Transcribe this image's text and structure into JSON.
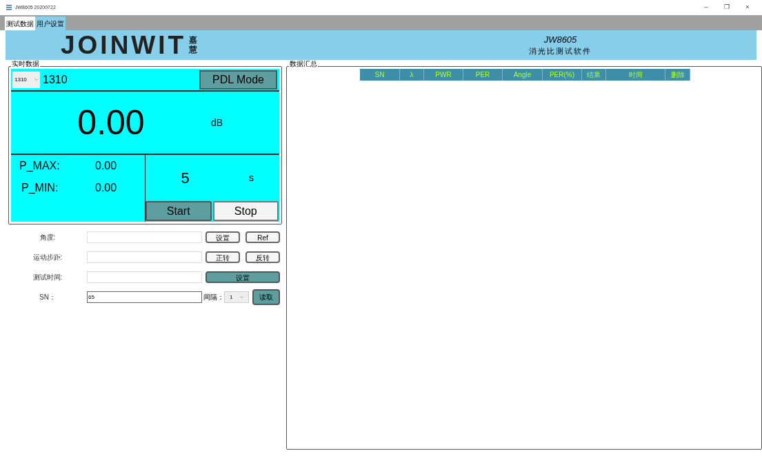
{
  "window": {
    "title": "JW8605 20200722",
    "controls": [
      "–",
      "❐",
      "×"
    ]
  },
  "tabs": [
    {
      "label": "测试数据",
      "selected": true
    },
    {
      "label": "用户设置",
      "selected": false
    }
  ],
  "header": {
    "logo": "JOINWIT",
    "logo_cn": "嘉慧",
    "model": "JW8605",
    "subtitle": "消光比测试软件"
  },
  "realtime": {
    "legend": "实时数据",
    "wavelength_select": "1310",
    "wavelength": "1310",
    "mode_button": "PDL Mode",
    "value": "0.00",
    "unit": "dB",
    "p_max_label": "P_MAX:",
    "p_max": "0.00",
    "p_min_label": "P_MIN:",
    "p_min": "0.00",
    "time": "5",
    "time_unit": "s",
    "buttons": [
      {
        "label": "Start",
        "active": true
      },
      {
        "label": "Stop",
        "active": false
      }
    ]
  },
  "settings": [
    {
      "label": "角度:",
      "buttons": [
        {
          "label": "设置",
          "active": false
        },
        {
          "label": "Ref",
          "active": false
        }
      ]
    },
    {
      "label": "运动步距:",
      "buttons": [
        {
          "label": "正转",
          "active": false
        },
        {
          "label": "反转",
          "active": false
        }
      ]
    },
    {
      "label": "测试时间:",
      "buttons": [
        {
          "label": "设置",
          "active": true
        }
      ]
    },
    {
      "label": "SN：",
      "value": "65",
      "interval_label": "间隔：",
      "interval": "1",
      "buttons": [
        {
          "label": "读取",
          "active": true
        }
      ]
    }
  ],
  "summary": {
    "legend": "数据汇总",
    "columns": [
      "SN",
      "λ",
      "PWR",
      "PER",
      "Angle",
      "PER(%)",
      "结果",
      "时间",
      "删除"
    ]
  }
}
